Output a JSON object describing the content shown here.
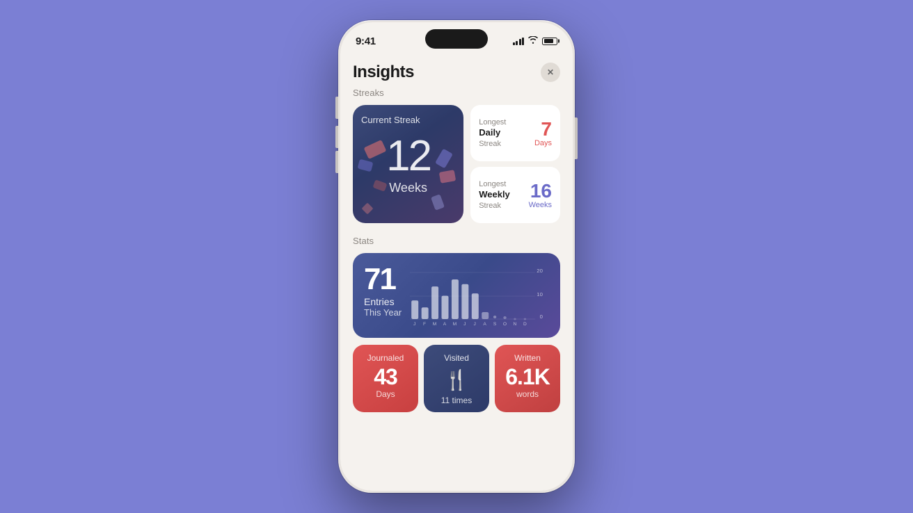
{
  "status_bar": {
    "time": "9:41"
  },
  "header": {
    "title": "Insights",
    "close_label": "✕"
  },
  "streaks": {
    "section_label": "Streaks",
    "current": {
      "title": "Current Streak",
      "number": "12",
      "unit": "Weeks"
    },
    "longest_daily": {
      "label_top": "Longest",
      "label_bold": "Daily",
      "label_bottom": "Streak",
      "number": "7",
      "unit": "Days"
    },
    "longest_weekly": {
      "label_top": "Longest",
      "label_bold": "Weekly",
      "label_bottom": "Streak",
      "number": "16",
      "unit": "Weeks"
    }
  },
  "stats": {
    "section_label": "Stats",
    "entries": {
      "number": "71",
      "label_line1": "Entries",
      "label_line2": "This Year"
    },
    "chart": {
      "months": [
        "J",
        "F",
        "M",
        "A",
        "M",
        "J",
        "J",
        "A",
        "S",
        "O",
        "N",
        "D"
      ],
      "values": [
        8,
        5,
        14,
        10,
        17,
        15,
        11,
        3,
        2,
        1,
        0,
        0
      ],
      "y_labels": [
        "20",
        "10",
        "0"
      ]
    }
  },
  "bottom_stats": {
    "journaled": {
      "label": "Journaled",
      "value": "43",
      "unit": "Days"
    },
    "visited": {
      "label": "Visited",
      "icon": "🍴",
      "value": "11 times"
    },
    "written": {
      "label": "Written",
      "value": "6.1K",
      "unit": "words"
    }
  }
}
